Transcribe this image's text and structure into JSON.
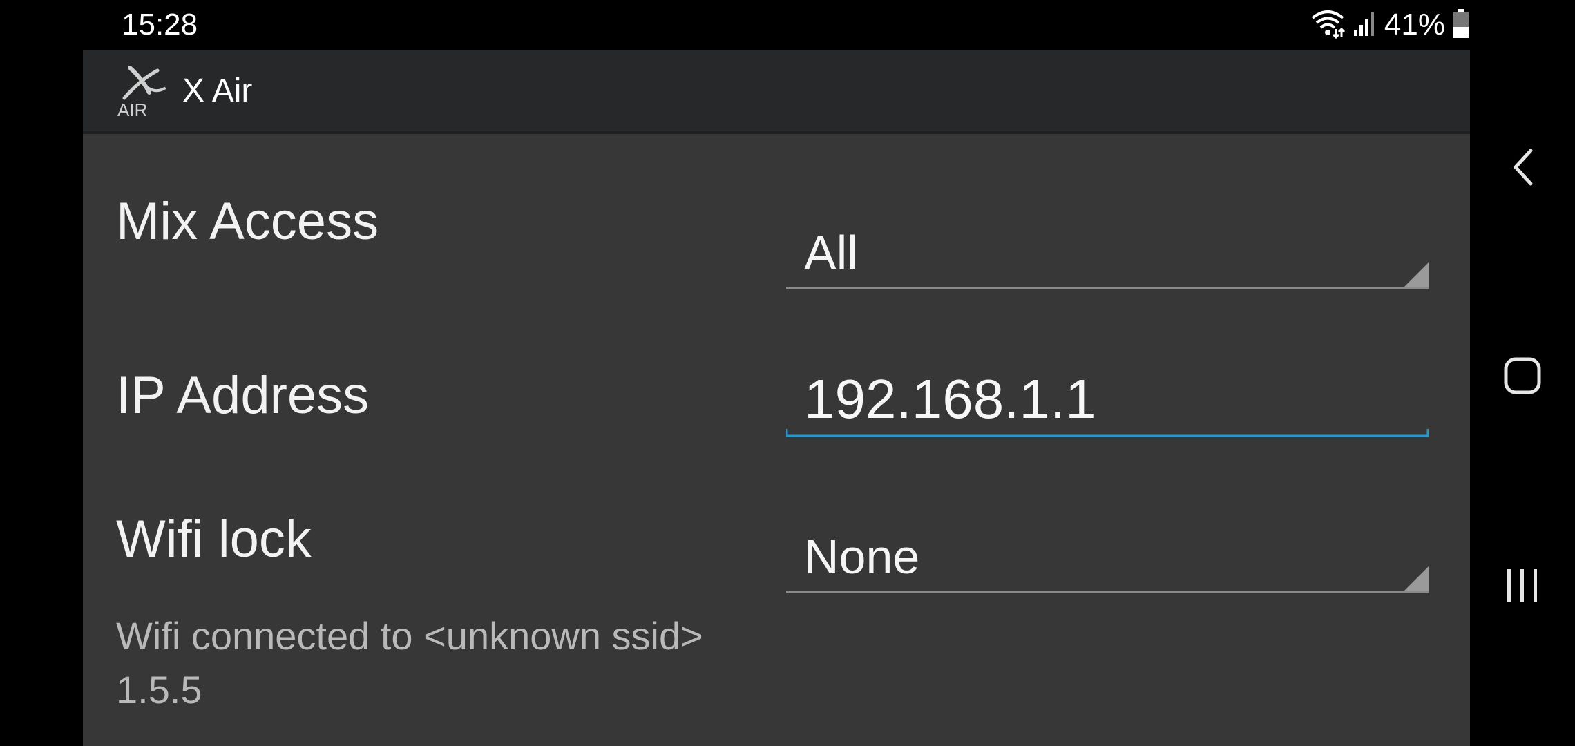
{
  "status_bar": {
    "time": "15:28",
    "battery_percent": "41%",
    "icons": [
      "wifi-icon",
      "signal-icon",
      "battery-icon"
    ],
    "battery_level": 0.41
  },
  "app": {
    "title": "X Air",
    "logo_text": "AIR"
  },
  "settings": {
    "mix_access": {
      "label": "Mix Access",
      "value": "All"
    },
    "ip_address": {
      "label": "IP Address",
      "value": "192.168.1.1"
    },
    "wifi_lock": {
      "label": "Wifi lock",
      "value": "None"
    }
  },
  "info": {
    "wifi_status": "Wifi connected to <unknown ssid>",
    "version": "1.5.5"
  },
  "nav_bar": {
    "buttons": [
      "back-icon",
      "home-icon",
      "recents-icon"
    ]
  },
  "colors": {
    "background": "#373737",
    "action_bar": "#26282a",
    "accent": "#1e9ad6",
    "text_primary": "#f2f2f2",
    "text_secondary": "#b9b9b9"
  }
}
